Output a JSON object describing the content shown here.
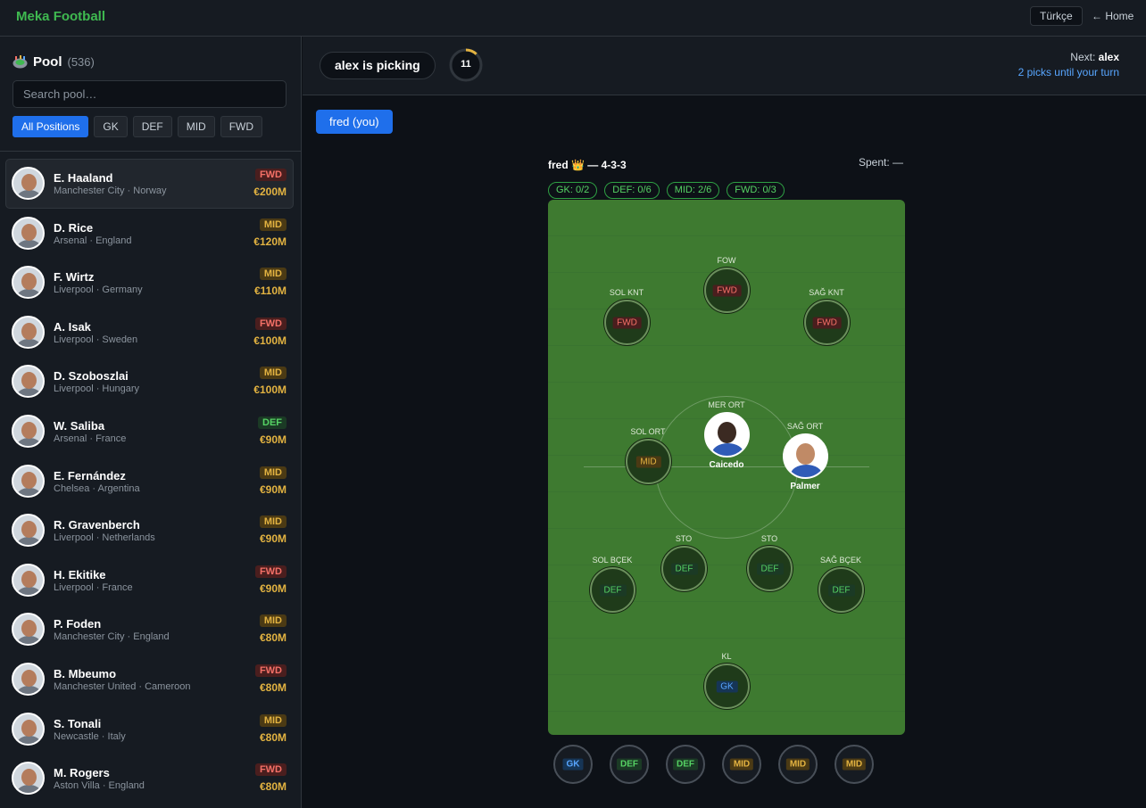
{
  "app": {
    "brand": "Meka Football",
    "lang_button": "Türkçe",
    "home_link": "← Home"
  },
  "pool": {
    "title": "Pool",
    "count": "(536)",
    "search_placeholder": "Search pool…",
    "filters": [
      "All Positions",
      "GK",
      "DEF",
      "MID",
      "FWD"
    ],
    "active_filter": "All Positions",
    "players": [
      {
        "name": "E. Haaland",
        "meta": "Manchester City · Norway",
        "pos": "FWD",
        "price": "€200M"
      },
      {
        "name": "D. Rice",
        "meta": "Arsenal · England",
        "pos": "MID",
        "price": "€120M"
      },
      {
        "name": "F. Wirtz",
        "meta": "Liverpool · Germany",
        "pos": "MID",
        "price": "€110M"
      },
      {
        "name": "A. Isak",
        "meta": "Liverpool · Sweden",
        "pos": "FWD",
        "price": "€100M"
      },
      {
        "name": "D. Szoboszlai",
        "meta": "Liverpool · Hungary",
        "pos": "MID",
        "price": "€100M"
      },
      {
        "name": "W. Saliba",
        "meta": "Arsenal · France",
        "pos": "DEF",
        "price": "€90M"
      },
      {
        "name": "E. Fernández",
        "meta": "Chelsea · Argentina",
        "pos": "MID",
        "price": "€90M"
      },
      {
        "name": "R. Gravenberch",
        "meta": "Liverpool · Netherlands",
        "pos": "MID",
        "price": "€90M"
      },
      {
        "name": "H. Ekitike",
        "meta": "Liverpool · France",
        "pos": "FWD",
        "price": "€90M"
      },
      {
        "name": "P. Foden",
        "meta": "Manchester City · England",
        "pos": "MID",
        "price": "€80M"
      },
      {
        "name": "B. Mbeumo",
        "meta": "Manchester United · Cameroon",
        "pos": "FWD",
        "price": "€80M"
      },
      {
        "name": "S. Tonali",
        "meta": "Newcastle · Italy",
        "pos": "MID",
        "price": "€80M"
      },
      {
        "name": "M. Rogers",
        "meta": "Aston Villa · England",
        "pos": "FWD",
        "price": "€80M"
      }
    ]
  },
  "draft": {
    "picking_label": "alex is picking",
    "timer_value": "11",
    "timer_fraction": 0.12,
    "next_label": "Next:",
    "next_name": "alex",
    "picks_until": "2 picks until your turn",
    "team_tab": "fred (you)"
  },
  "team": {
    "header": "fred 👑 — 4-3-3",
    "spent": "Spent: —",
    "counters": [
      "GK: 0/2",
      "DEF: 0/6",
      "MID: 2/6",
      "FWD: 0/3"
    ],
    "slots": {
      "fow": {
        "label": "FOW",
        "tag": "FWD"
      },
      "sol_knt": {
        "label": "SOL KNT",
        "tag": "FWD"
      },
      "sag_knt": {
        "label": "SAĞ KNT",
        "tag": "FWD"
      },
      "mer_ort": {
        "label": "MER ORT",
        "player": "Caicedo"
      },
      "sol_ort": {
        "label": "SOL ORT",
        "tag": "MID"
      },
      "sag_ort": {
        "label": "SAĞ ORT",
        "player": "Palmer"
      },
      "sol_bcek": {
        "label": "SOL BÇEK",
        "tag": "DEF"
      },
      "sto1": {
        "label": "STO",
        "tag": "DEF"
      },
      "sto2": {
        "label": "STO",
        "tag": "DEF"
      },
      "sag_bcek": {
        "label": "SAĞ BÇEK",
        "tag": "DEF"
      },
      "kl": {
        "label": "KL",
        "tag": "GK"
      }
    },
    "bench": [
      "GK",
      "DEF",
      "DEF",
      "MID",
      "MID",
      "MID"
    ]
  }
}
